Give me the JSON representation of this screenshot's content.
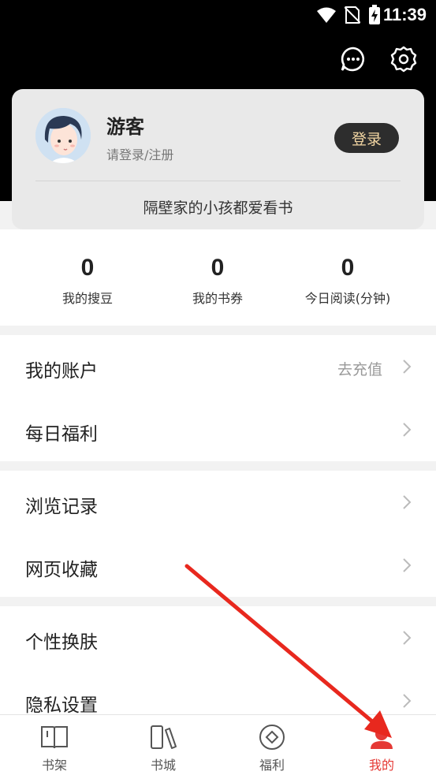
{
  "status_bar": {
    "time": "11:39"
  },
  "profile": {
    "username": "游客",
    "login_hint": "请登录/注册",
    "login_button": "登录",
    "slogan": "隔壁家的小孩都爱看书"
  },
  "stats": [
    {
      "value": "0",
      "label": "我的搜豆"
    },
    {
      "value": "0",
      "label": "我的书券"
    },
    {
      "value": "0",
      "label": "今日阅读(分钟)"
    }
  ],
  "menu": {
    "account": {
      "label": "我的账户",
      "right": "去充值"
    },
    "daily_welfare": {
      "label": "每日福利"
    },
    "browse_history": {
      "label": "浏览记录"
    },
    "web_favorites": {
      "label": "网页收藏"
    },
    "skin": {
      "label": "个性换肤"
    },
    "privacy": {
      "label": "隐私设置"
    }
  },
  "bottom_nav": {
    "items": [
      {
        "label": "书架"
      },
      {
        "label": "书城"
      },
      {
        "label": "福利"
      },
      {
        "label": "我的"
      }
    ],
    "active_color": "#e53935"
  },
  "colors": {
    "accent": "#e53935",
    "header_bg": "#000000",
    "card_bg": "#e9e9e9"
  }
}
